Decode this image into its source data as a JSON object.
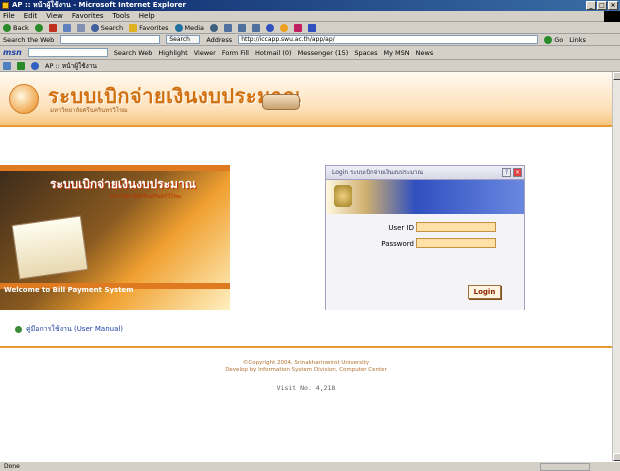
{
  "window": {
    "title": "AP :: หน้าผู้ใช้งาน - Microsoft Internet Explorer",
    "buttons": [
      "_",
      "□",
      "×"
    ]
  },
  "menu": [
    "File",
    "Edit",
    "View",
    "Favorites",
    "Tools",
    "Help"
  ],
  "toolbar": {
    "back": "Back",
    "search": "Search",
    "favorites": "Favorites",
    "media": "Media"
  },
  "address_row": {
    "search_field_label": "Search the Web",
    "search_button": "Search",
    "address_label": "Address",
    "url": "http://iccapp.swu.ac.th/app/ap/",
    "go": "Go",
    "links": "Links"
  },
  "msn_bar": {
    "logo": "msn",
    "items": [
      "Search Web",
      "Highlight",
      "Viewer",
      "Form Fill",
      "Hotmail (0)",
      "Messenger (15)",
      "Spaces",
      "My MSN",
      "News"
    ]
  },
  "tab_row": {
    "tab_title": "AP :: หน้าผู้ใช้งาน"
  },
  "page": {
    "header_title": "ระบบเบิกจ่ายเงินงบประมาณ",
    "header_subtitle": "มหาวิทยาลัยศรีนครินทรวิโรฒ",
    "banner_title": "ระบบเบิกจ่ายเงินงบประมาณ",
    "banner_subtitle": "มหาวิทยาลัยศรีนครินทรวิโรฒ",
    "banner_welcome": "Welcome to Bill Payment System",
    "login": {
      "title": "Login ระบบเบิกจ่ายเงินงบประมาณ",
      "userid_label": "User ID",
      "password_label": "Password",
      "button": "Login"
    },
    "manual_link": "คู่มือการใช้งาน (User Manual)",
    "footer_copyright": "©Copyright 2004, Srinakharinwirot University",
    "footer_dev": "Develop by Information System Division, Computer Center",
    "visit": "Visit No. 4,218"
  },
  "status": {
    "text": "Done"
  }
}
